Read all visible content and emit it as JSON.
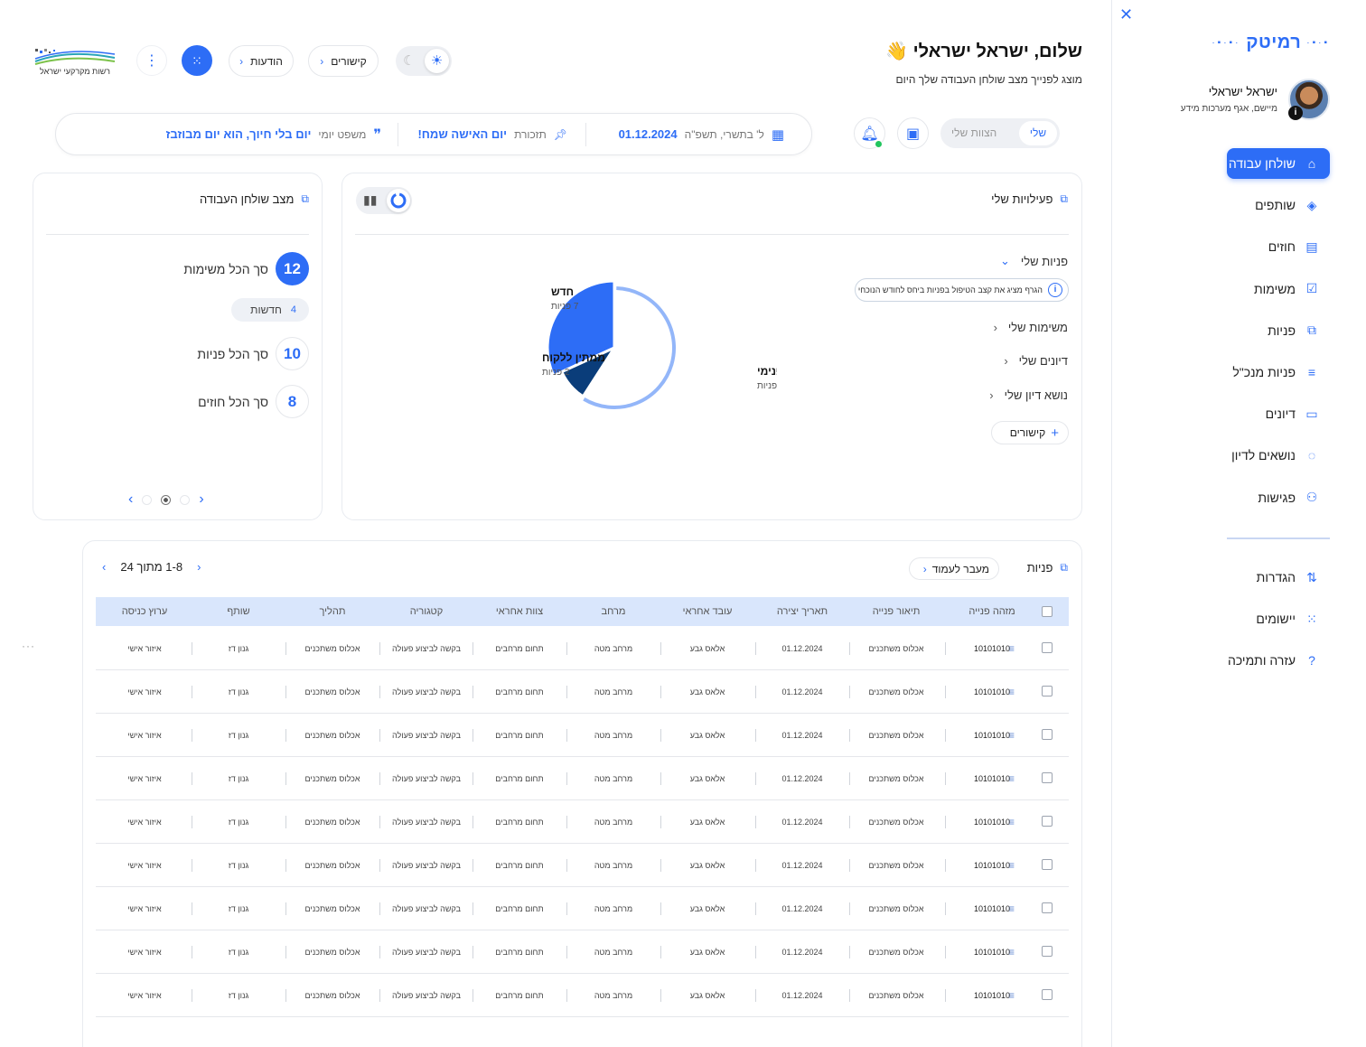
{
  "colors": {
    "accent": "#2d6df6",
    "accent_dark": "#0a3d7a",
    "accent_light": "#93b6f9",
    "table_header": "#d9e6fc"
  },
  "sidebar": {
    "brand": "רמיטק",
    "user": {
      "name": "ישראל ישראלי",
      "role": "מיישם, אגף מערכות מידע",
      "badge": "i"
    },
    "items": [
      {
        "label": "שולחן עבודה",
        "icon": "home-icon"
      },
      {
        "label": "שותפים",
        "icon": "handshake-icon"
      },
      {
        "label": "חוזים",
        "icon": "contract-icon"
      },
      {
        "label": "משימות",
        "icon": "task-icon"
      },
      {
        "label": "פניות",
        "icon": "inquiries-icon"
      },
      {
        "label": "פניות מנכ\"ל",
        "icon": "ceo-inquiries-icon"
      },
      {
        "label": "דיונים",
        "icon": "chat-icon"
      },
      {
        "label": "נושאים לדיון",
        "icon": "lightbulb-icon"
      },
      {
        "label": "פגישות",
        "icon": "people-icon"
      }
    ],
    "bottom_items": [
      {
        "label": "הגדרות",
        "icon": "settings-icon"
      },
      {
        "label": "יישומים",
        "icon": "apps-grid-icon"
      },
      {
        "label": "עזרה ותמיכה",
        "icon": "help-icon"
      }
    ]
  },
  "header": {
    "greeting": "שלום, ישראל ישראלי",
    "wave": "👋",
    "subtitle": "מוצג לפנייך מצב שולחן העבודה שלך היום",
    "links_btn": "קישורים",
    "notices_btn": "הודעות",
    "logo_text": "רשות מקרקעי ישראל"
  },
  "infobar": {
    "date_hebrew": "ל' בתשרי, תשפ\"ה",
    "date": "01.12.2024",
    "reminder_label": "תזכורת",
    "reminder": "יום האישה שמח!",
    "quote_label": "משפט יומי",
    "quote": "יום בלי חיוך, הוא יום מבוזבז"
  },
  "view_toggle": {
    "mine": "שלי",
    "others": "הצוות שלי"
  },
  "workstate": {
    "title": "מצב שולחן העבודה",
    "tasks": {
      "value": "12",
      "label": "סך הכל משימות"
    },
    "new_chip": {
      "value": "4",
      "label": "חדשות"
    },
    "inquiries": {
      "value": "10",
      "label": "סך הכל פניות"
    },
    "contracts": {
      "value": "8",
      "label": "סך הכל חוזים"
    }
  },
  "activity": {
    "title": "פעילויות שלי",
    "items": [
      "פניות שלי",
      "משימות שלי",
      "דיונים שלי",
      "נושא דיון שלי"
    ],
    "note": "הגרף מציג את קצב הטיפול בפניות ביחס לחודש הנוכחי",
    "link_btn": "קישורים"
  },
  "chart_data": {
    "type": "pie",
    "categories": [
      "בטיפול פנימי",
      "חדש",
      "ממתין ללקוח"
    ],
    "values": [
      13,
      7,
      2
    ],
    "labels": [
      "13 פניות",
      "7 פניות",
      "2 פניות"
    ],
    "colors": [
      "#93b6f9",
      "#2d6df6",
      "#0a3d7a"
    ]
  },
  "table": {
    "title": "פניות",
    "goto_btn": "מעבר לעמוד",
    "pager": "1-8 מתוך 24",
    "columns": [
      "מזהה פנייה",
      "תיאור פנייה",
      "תאריך יצירה",
      "עובד אחראי",
      "מרחב",
      "צוות אחראי",
      "קטגוריה",
      "תהליך",
      "שותף",
      "ערוץ כניסה"
    ],
    "rows": [
      [
        "10101010",
        "אכלוס משתכנים",
        "01.12.2024",
        "אלאס גבע",
        "מרחב מטה",
        "תחום מרחבים",
        "בקשה לביצוע פעולה",
        "אכלוס משתכנים",
        "גנון דז",
        "איזור אישי"
      ],
      [
        "10101010",
        "אכלוס משתכנים",
        "01.12.2024",
        "אלאס גבע",
        "מרחב מטה",
        "תחום מרחבים",
        "בקשה לביצוע פעולה",
        "אכלוס משתכנים",
        "גנון דז",
        "איזור אישי"
      ],
      [
        "10101010",
        "אכלוס משתכנים",
        "01.12.2024",
        "אלאס גבע",
        "מרחב מטה",
        "תחום מרחבים",
        "בקשה לביצוע פעולה",
        "אכלוס משתכנים",
        "גנון דז",
        "איזור אישי"
      ],
      [
        "10101010",
        "אכלוס משתכנים",
        "01.12.2024",
        "אלאס גבע",
        "מרחב מטה",
        "תחום מרחבים",
        "בקשה לביצוע פעולה",
        "אכלוס משתכנים",
        "גנון דז",
        "איזור אישי"
      ],
      [
        "10101010",
        "אכלוס משתכנים",
        "01.12.2024",
        "אלאס גבע",
        "מרחב מטה",
        "תחום מרחבים",
        "בקשה לביצוע פעולה",
        "אכלוס משתכנים",
        "גנון דז",
        "איזור אישי"
      ],
      [
        "10101010",
        "אכלוס משתכנים",
        "01.12.2024",
        "אלאס גבע",
        "מרחב מטה",
        "תחום מרחבים",
        "בקשה לביצוע פעולה",
        "אכלוס משתכנים",
        "גנון דז",
        "איזור אישי"
      ],
      [
        "10101010",
        "אכלוס משתכנים",
        "01.12.2024",
        "אלאס גבע",
        "מרחב מטה",
        "תחום מרחבים",
        "בקשה לביצוע פעולה",
        "אכלוס משתכנים",
        "גנון דז",
        "איזור אישי"
      ],
      [
        "10101010",
        "אכלוס משתכנים",
        "01.12.2024",
        "אלאס גבע",
        "מרחב מטה",
        "תחום מרחבים",
        "בקשה לביצוע פעולה",
        "אכלוס משתכנים",
        "גנון דז",
        "איזור אישי"
      ],
      [
        "10101010",
        "אכלוס משתכנים",
        "01.12.2024",
        "אלאס גבע",
        "מרחב מטה",
        "תחום מרחבים",
        "בקשה לביצוע פעולה",
        "אכלוס משתכנים",
        "גנון דז",
        "איזור אישי"
      ]
    ]
  }
}
